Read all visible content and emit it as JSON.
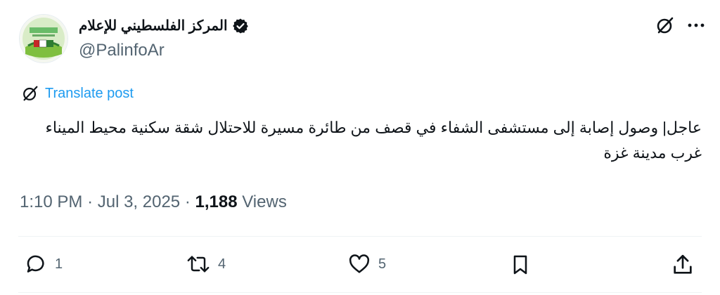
{
  "author": {
    "name": "المركز الفلسطيني للإعلام",
    "handle": "@PalinfoAr",
    "avatar_icon": "palinfo-logo",
    "verified_icon": "verified-badge-icon"
  },
  "translate": {
    "label": "Translate post"
  },
  "tweet": {
    "text": "عاجل| وصول إصابة إلى مستشفى الشفاء في قصف من طائرة مسيرة للاحتلال شقة سكنية محيط الميناء غرب مدينة غزة"
  },
  "meta": {
    "time": "1:10 PM",
    "date": "Jul 3, 2025",
    "separator": "·",
    "views_count": "1,188",
    "views_label": "Views"
  },
  "actions": {
    "replies": "1",
    "reposts": "4",
    "likes": "5"
  },
  "colors": {
    "accent": "#1d9bf0",
    "muted": "#536471",
    "text": "#0f1419",
    "divider": "#eff3f4"
  }
}
